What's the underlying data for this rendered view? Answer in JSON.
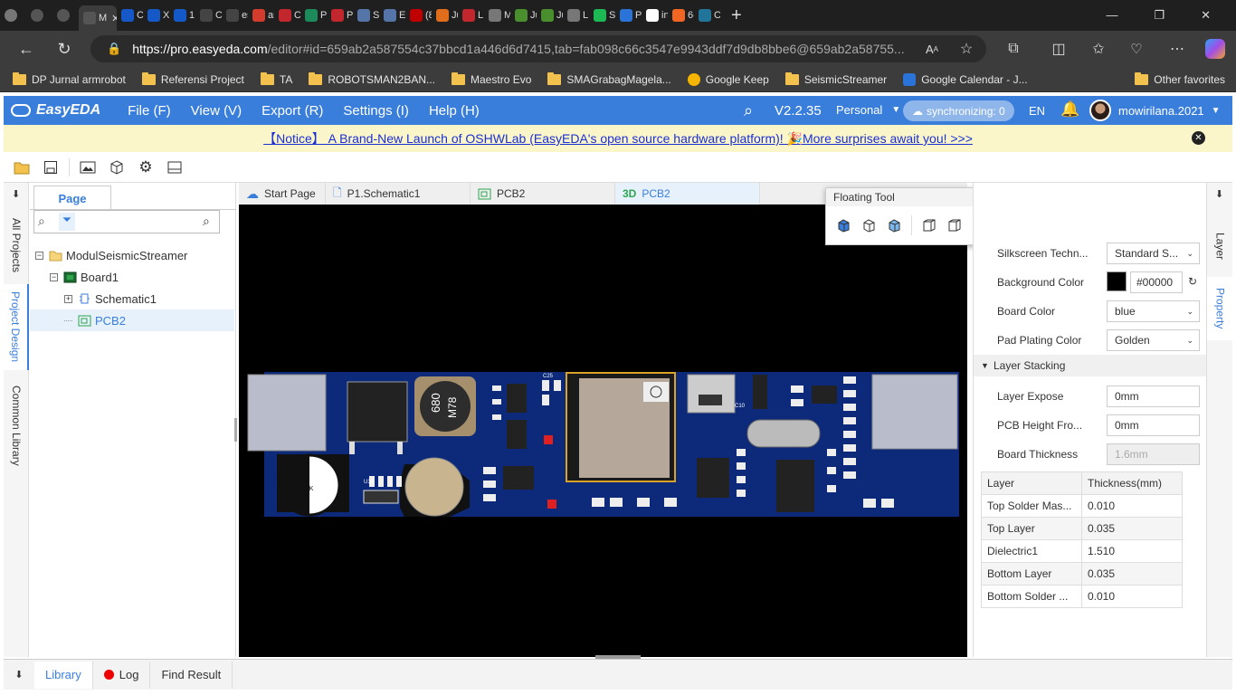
{
  "browser": {
    "tabs": [
      {
        "label": "",
        "icon": "profile-icon",
        "color": "#777777"
      },
      {
        "label": "",
        "icon": "workspaces-icon",
        "color": "#555555"
      },
      {
        "label": "",
        "icon": "tab-actions-icon",
        "color": "#555555"
      },
      {
        "label": "M",
        "icon": "easyeda-icon",
        "color": "#555555",
        "active": true
      },
      {
        "label": "Cl",
        "icon": "lcsc-icon",
        "color": "#1559c8"
      },
      {
        "label": "Xl",
        "icon": "lcsc-icon",
        "color": "#1559c8"
      },
      {
        "label": "1N",
        "icon": "lcsc-icon",
        "color": "#1559c8"
      },
      {
        "label": "Cl",
        "icon": "openai-icon",
        "color": "#444444"
      },
      {
        "label": "es",
        "icon": "document-icon",
        "color": "#444444"
      },
      {
        "label": "ar",
        "icon": "red-circle-icon",
        "color": "#d33b2c"
      },
      {
        "label": "Cl",
        "icon": "pdf-icon",
        "color": "#c2272d"
      },
      {
        "label": "PC",
        "icon": "eda-icon",
        "color": "#1d8a5b"
      },
      {
        "label": "PC",
        "icon": "pdf-icon",
        "color": "#c2272d"
      },
      {
        "label": "Se",
        "icon": "cloud-icon",
        "color": "#5575a8"
      },
      {
        "label": "Ea",
        "icon": "cloud-icon",
        "color": "#5575a8"
      },
      {
        "label": "(8",
        "icon": "youtube-icon",
        "color": "#c00000"
      },
      {
        "label": "Ju",
        "icon": "orange-icon",
        "color": "#e06d1c"
      },
      {
        "label": "LI",
        "icon": "pdf-icon",
        "color": "#c2272d"
      },
      {
        "label": "M",
        "icon": "gear-tab-icon",
        "color": "#777777"
      },
      {
        "label": "Ju",
        "icon": "owl-icon",
        "color": "#4a8f2e"
      },
      {
        "label": "Ju",
        "icon": "owl-icon",
        "color": "#4a8f2e"
      },
      {
        "label": "LI",
        "icon": "lines-icon",
        "color": "#777777"
      },
      {
        "label": "Sp",
        "icon": "spotify-icon",
        "color": "#1db954"
      },
      {
        "label": "PC",
        "icon": "jlc-icon",
        "color": "#2a73d8"
      },
      {
        "label": "in",
        "icon": "google-icon",
        "color": "#ffffff"
      },
      {
        "label": "6(",
        "icon": "s-icon",
        "color": "#f26522"
      },
      {
        "label": "Cl",
        "icon": "wordpress-icon",
        "color": "#21759b"
      }
    ],
    "url_host": "https://pro.easyeda.com",
    "url_rest": "/editor#id=659ab2a587554c37bbcd1a446d6d7415,tab=fab098c66c3547e9943ddf7d9db8bbe6@659ab2a58755...",
    "bookmarks": [
      {
        "label": "DP Jurnal armrobot",
        "icon": "folder-icon"
      },
      {
        "label": "Referensi Project",
        "icon": "folder-icon"
      },
      {
        "label": "TA",
        "icon": "folder-icon"
      },
      {
        "label": "ROBOTSMAN2BAN...",
        "icon": "folder-icon"
      },
      {
        "label": "Maestro Evo",
        "icon": "folder-icon"
      },
      {
        "label": "SMAGrabagMagela...",
        "icon": "folder-icon"
      },
      {
        "label": "Google Keep",
        "icon": "keep-icon"
      },
      {
        "label": "SeismicStreamer",
        "icon": "folder-icon"
      },
      {
        "label": "Google Calendar - J...",
        "icon": "calendar-icon"
      }
    ],
    "other_favorites": "Other favorites"
  },
  "app": {
    "logo": "EasyEDA",
    "menus": [
      "File (F)",
      "View (V)",
      "Export (R)",
      "Settings (I)",
      "Help (H)"
    ],
    "version": "V2.2.35",
    "workspace": "Personal",
    "sync": "synchronizing: 0",
    "language": "EN",
    "user": "mowirilana.2021",
    "accent": "#3a7edc"
  },
  "notice": {
    "text": "【Notice】 A Brand-New Launch of OSHWLab (EasyEDA's open source hardware platform)! 🎉More surprises await you! >>>"
  },
  "left_tabs": [
    "All Projects",
    "Project Design",
    "Common Library"
  ],
  "left_panel": {
    "page_tab": "Page",
    "search_placeholder": "",
    "tree": [
      {
        "label": "ModulSeismicStreamer",
        "level": 0,
        "icon": "folder-icon",
        "expander": "⊟"
      },
      {
        "label": "Board1",
        "level": 1,
        "icon": "board-icon",
        "expander": "⊟"
      },
      {
        "label": "Schematic1",
        "level": 2,
        "icon": "schematic-icon",
        "expander": "⊞"
      },
      {
        "label": "PCB2",
        "level": 2,
        "icon": "pcb-icon",
        "expander": "",
        "selected": true
      }
    ]
  },
  "doc_tabs": [
    {
      "label": "Start Page",
      "icon": "cloud-icon"
    },
    {
      "label": "P1.Schematic1",
      "icon": "document-icon"
    },
    {
      "label": "PCB2",
      "icon": "pcb-icon"
    },
    {
      "label": "PCB2",
      "icon": "3d-icon",
      "prefix": "3D",
      "active": true
    }
  ],
  "floating_tool": {
    "title": "Floating Tool"
  },
  "properties": {
    "silkscreen_label": "Silkscreen Techn...",
    "silkscreen_value": "Standard S...",
    "bg_label": "Background Color",
    "bg_value": "#00000",
    "bg_color": "#000000",
    "board_color_label": "Board Color",
    "board_color_value": "blue",
    "pad_label": "Pad Plating Color",
    "pad_value": "Golden",
    "stacking_header": "Layer Stacking",
    "layer_expose_label": "Layer Expose",
    "layer_expose_value": "0mm",
    "pcb_height_label": "PCB Height Fro...",
    "pcb_height_value": "0mm",
    "thickness_label": "Board Thickness",
    "thickness_value": "1.6mm",
    "table_headers": [
      "Layer",
      "Thickness(mm)"
    ],
    "table_rows": [
      [
        "Top Solder Mas...",
        "0.010"
      ],
      [
        "Top Layer",
        "0.035"
      ],
      [
        "Dielectric1",
        "1.510"
      ],
      [
        "Bottom Layer",
        "0.035"
      ],
      [
        "Bottom Solder ...",
        "0.010"
      ]
    ]
  },
  "right_tabs": [
    "Layer",
    "Property"
  ],
  "bottom_tabs": [
    "Library",
    "Log",
    "Find Result"
  ],
  "pcb": {
    "labels": [
      "680",
      "M78",
      "YCK",
      "U14",
      "C25",
      "C10"
    ]
  }
}
